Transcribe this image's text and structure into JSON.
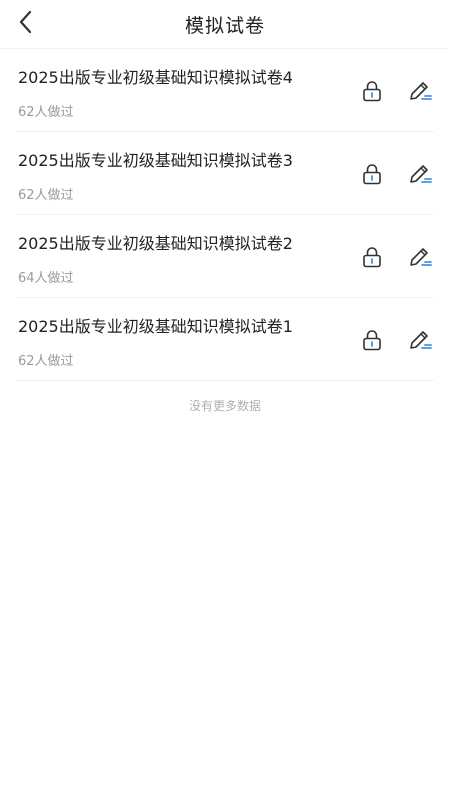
{
  "header": {
    "title": "模拟试卷"
  },
  "papers": [
    {
      "title": "2025出版专业初级基础知识模拟试卷4",
      "done": "62人做过"
    },
    {
      "title": "2025出版专业初级基础知识模拟试卷3",
      "done": "62人做过"
    },
    {
      "title": "2025出版专业初级基础知识模拟试卷2",
      "done": "64人做过"
    },
    {
      "title": "2025出版专业初级基础知识模拟试卷1",
      "done": "62人做过"
    }
  ],
  "footer": {
    "no_more": "没有更多数据"
  },
  "icons": {
    "back": "chevron-left-icon",
    "lock": "lock-icon",
    "edit": "pencil-icon"
  },
  "colors": {
    "accent": "#4a90e2"
  }
}
